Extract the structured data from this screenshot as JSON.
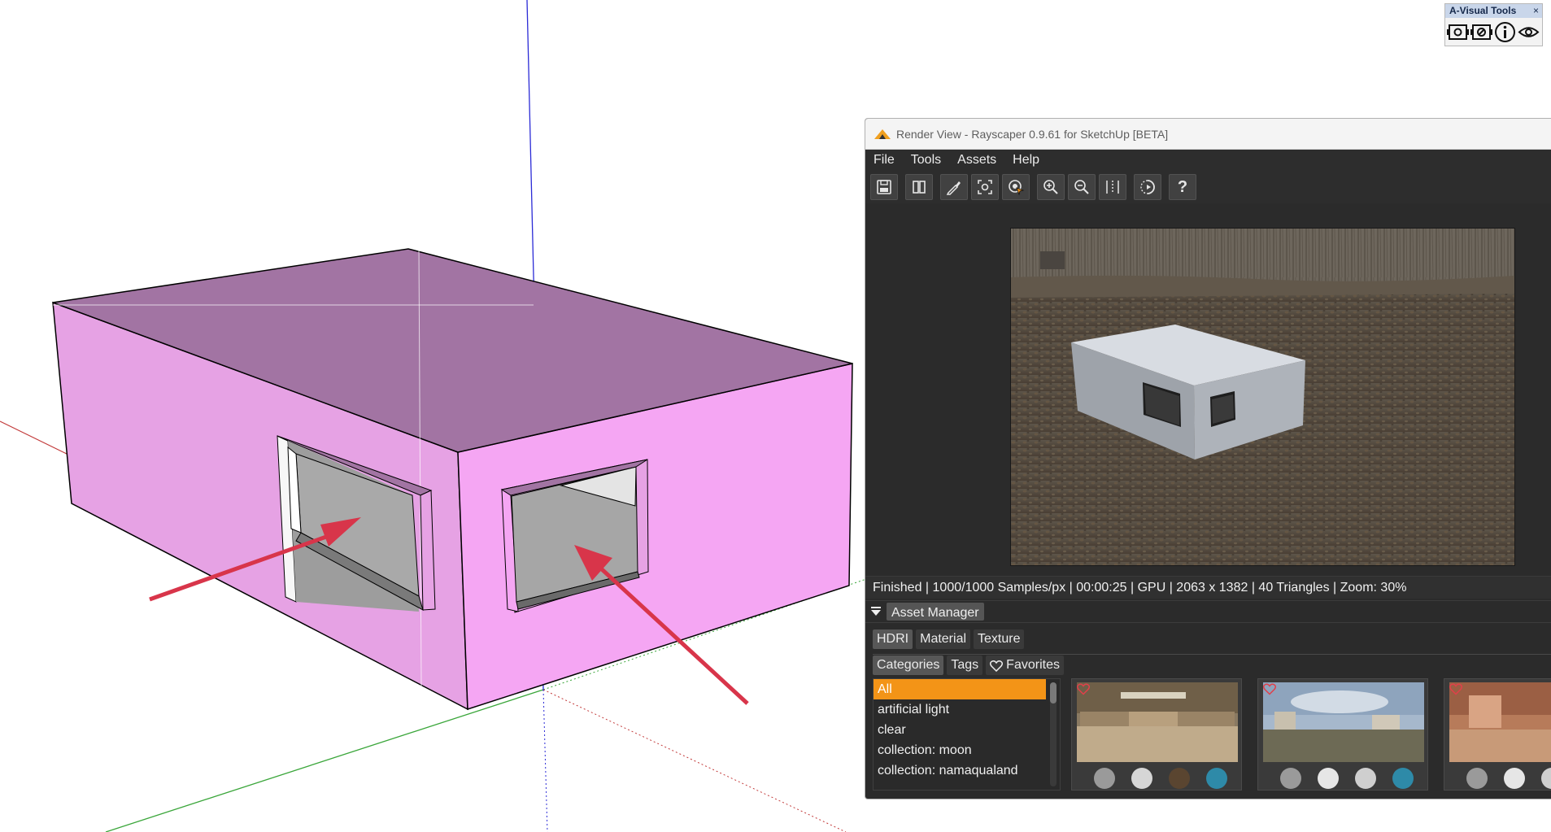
{
  "floating_toolbar": {
    "title": "A-Visual Tools",
    "close_glyph": "×",
    "icons": [
      "camera-target-icon",
      "camera-settings-icon",
      "info-icon",
      "eye-icon"
    ]
  },
  "render_window": {
    "title": "Render View - Rayscaper 0.9.61 for SketchUp [BETA]",
    "menu": [
      "File",
      "Tools",
      "Assets",
      "Help"
    ],
    "toolbar_icons": [
      "save-icon",
      "split-view-icon",
      "eyedropper-icon",
      "focus-frame-icon",
      "pick-focus-icon",
      "zoom-in-icon",
      "zoom-out-icon",
      "column-split-icon",
      "denoise-icon",
      "help-icon"
    ],
    "help_glyph": "?",
    "status": "Finished | 1000/1000 Samples/px | 00:00:25 | GPU | 2063 x 1382 | 40 Triangles | Zoom: 30%"
  },
  "asset_manager": {
    "label": "Asset Manager",
    "asset_tabs": [
      "HDRI",
      "Material",
      "Texture"
    ],
    "active_asset_tab": "HDRI",
    "sub_tabs": [
      "Categories",
      "Tags",
      "Favorites"
    ],
    "active_sub_tab": "Categories",
    "categories": [
      "All",
      "artificial light",
      "clear",
      "collection: moon",
      "collection: namaqualand"
    ],
    "selected_category": "All"
  },
  "colors": {
    "accent": "#f39417",
    "model_face_pink": "#f5a6f3",
    "model_roof": "#a274a3",
    "axis_red": "#c23a3a",
    "axis_green": "#3aa63a",
    "axis_blue": "#2b2bd6",
    "arrow_red": "#d8354a"
  }
}
